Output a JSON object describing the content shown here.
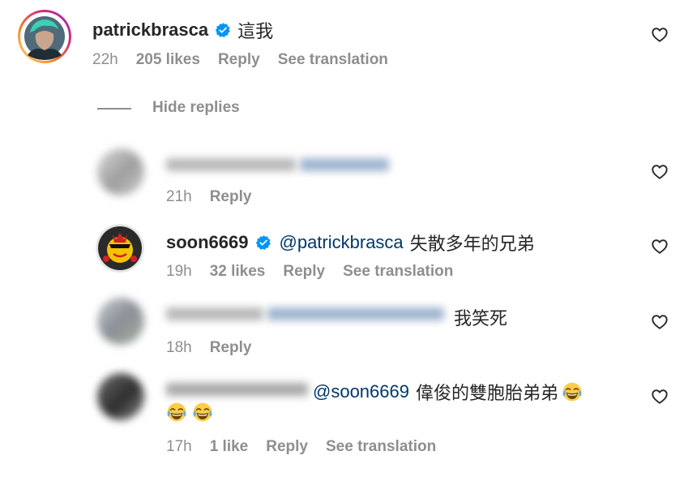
{
  "comment": {
    "username": "patrickbrasca",
    "text": "這我",
    "time": "22h",
    "likes": "205 likes",
    "reply": "Reply",
    "translate": "See translation"
  },
  "hide_replies": "Hide replies",
  "replies": [
    {
      "time": "21h",
      "reply": "Reply"
    },
    {
      "username": "soon6669",
      "mention": "@patrickbrasca",
      "text": "失散多年的兄弟",
      "time": "19h",
      "likes": "32 likes",
      "reply": "Reply",
      "translate": "See translation"
    },
    {
      "text": "我笑死",
      "time": "18h",
      "reply": "Reply"
    },
    {
      "mention": "@soon6669",
      "text": "偉俊的雙胞胎弟弟",
      "time": "17h",
      "likes": "1 like",
      "reply": "Reply",
      "translate": "See translation"
    }
  ],
  "icons": {
    "like": "heart-outline-icon",
    "verified": "verified-badge-icon",
    "emoji": "face-with-tears-of-joy-emoji"
  },
  "colors": {
    "text": "#262626",
    "secondary": "#8e8e8e",
    "mention": "#00376b",
    "verified": "#0095f6",
    "story_ring_start": "#feda75",
    "story_ring_end": "#d62976"
  }
}
